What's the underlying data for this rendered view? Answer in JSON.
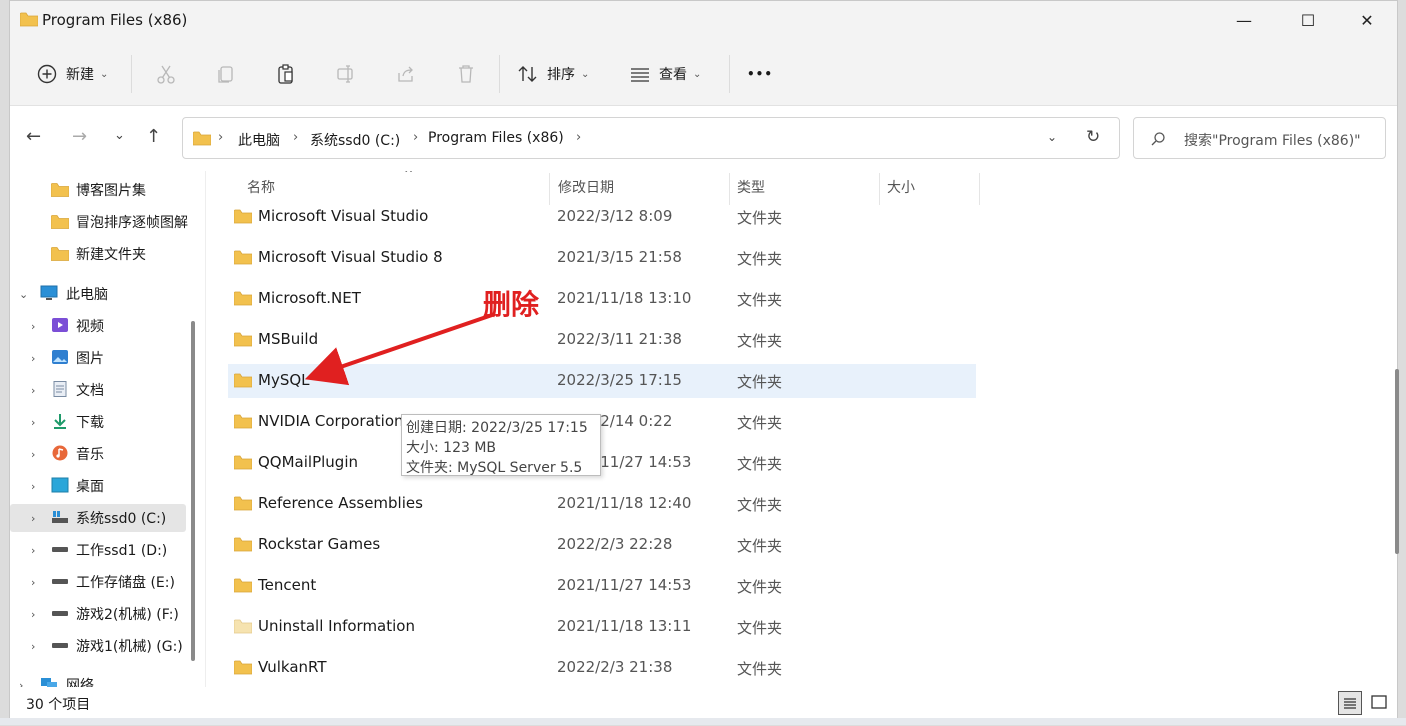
{
  "window": {
    "title": "Program Files (x86)",
    "controls": {
      "minimize": "—",
      "maximize": "☐",
      "close": "✕"
    }
  },
  "toolbar": {
    "new_label": "新建",
    "sort_label": "排序",
    "view_label": "查看",
    "more_label": "•••"
  },
  "address": {
    "crumbs": [
      "此电脑",
      "系统ssd0 (C:)",
      "Program Files (x86)"
    ],
    "search_placeholder": "搜索\"Program Files (x86)\""
  },
  "sidebar": {
    "quick_items": [
      "博客图片集",
      "冒泡排序逐帧图解",
      "新建文件夹"
    ],
    "this_pc": "此电脑",
    "pc_items": [
      "视频",
      "图片",
      "文档",
      "下载",
      "音乐",
      "桌面",
      "系统ssd0 (C:)",
      "工作ssd1  (D:)",
      "工作存储盘 (E:)",
      "游戏2(机械) (F:)",
      "游戏1(机械) (G:)"
    ],
    "network": "网络"
  },
  "columns": {
    "name": "名称",
    "date": "修改日期",
    "type": "类型",
    "size": "大小"
  },
  "files": [
    {
      "name": "Microsoft Visual Studio",
      "date": "2022/3/12 8:09",
      "type": "文件夹"
    },
    {
      "name": "Microsoft Visual Studio 8",
      "date": "2021/3/15 21:58",
      "type": "文件夹"
    },
    {
      "name": "Microsoft.NET",
      "date": "2021/11/18 13:10",
      "type": "文件夹"
    },
    {
      "name": "MSBuild",
      "date": "2022/3/11 21:38",
      "type": "文件夹"
    },
    {
      "name": "MySQL",
      "date": "2022/3/25 17:15",
      "type": "文件夹"
    },
    {
      "name": "NVIDIA Corporation",
      "date": "2022/2/14 0:22",
      "type": "文件夹"
    },
    {
      "name": "QQMailPlugin",
      "date": "2021/11/27 14:53",
      "type": "文件夹"
    },
    {
      "name": "Reference Assemblies",
      "date": "2021/11/18 12:40",
      "type": "文件夹"
    },
    {
      "name": "Rockstar Games",
      "date": "2022/2/3 22:28",
      "type": "文件夹"
    },
    {
      "name": "Tencent",
      "date": "2021/11/27 14:53",
      "type": "文件夹"
    },
    {
      "name": "Uninstall Information",
      "date": "2021/11/18 13:11",
      "type": "文件夹"
    },
    {
      "name": "VulkanRT",
      "date": "2022/2/3 21:38",
      "type": "文件夹"
    }
  ],
  "tooltip": {
    "created": "创建日期: 2022/3/25 17:15",
    "size": "大小: 123 MB",
    "folder": "文件夹: MySQL Server 5.5"
  },
  "annotation": {
    "text": "删除",
    "color": "#e02020"
  },
  "status": {
    "count": "30 个项目"
  },
  "colors": {
    "folder": "#f2c14e",
    "selected_row": "#e8f1fb",
    "selected_nav": "#e5e5e5"
  }
}
